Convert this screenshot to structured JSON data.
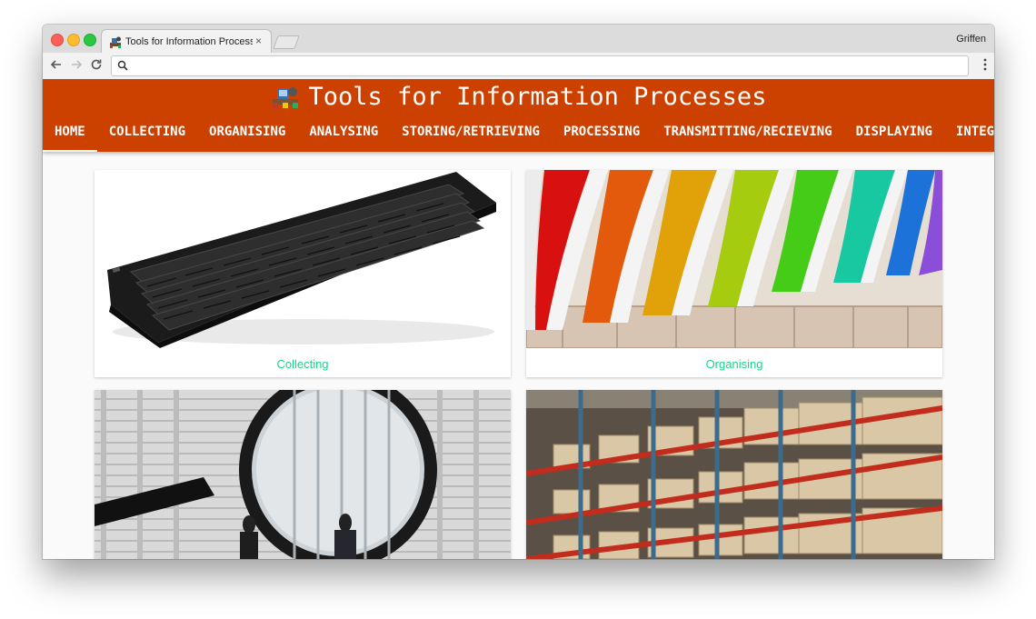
{
  "browser": {
    "tab_title": "Tools for Information Processes",
    "tab_close": "×",
    "profile_name": "Griffen",
    "address_value": "",
    "icons": {
      "back": "back-arrow-icon",
      "forward": "forward-arrow-icon",
      "reload": "reload-icon",
      "search": "search-icon",
      "menu": "kebab-menu-icon"
    }
  },
  "site": {
    "title": "Tools for Information Processes",
    "logo": "tools-logo-icon",
    "colors": {
      "header": "#cc4000",
      "accent": "#1bd38a",
      "text": "#ffffff"
    },
    "nav": [
      {
        "label": "HOME",
        "active": true
      },
      {
        "label": "COLLECTING",
        "active": false
      },
      {
        "label": "ORGANISING",
        "active": false
      },
      {
        "label": "ANALYSING",
        "active": false
      },
      {
        "label": "STORING/RETRIEVING",
        "active": false
      },
      {
        "label": "PROCESSING",
        "active": false
      },
      {
        "label": "TRANSMITTING/RECIEVING",
        "active": false
      },
      {
        "label": "DISPLAYING",
        "active": false
      },
      {
        "label": "INTEGRATION",
        "active": false
      }
    ]
  },
  "cards": [
    {
      "label": "Collecting",
      "image": "keyboard-image"
    },
    {
      "label": "Organising",
      "image": "coloured-folders-image"
    },
    {
      "label": "",
      "image": "magnifying-glass-image"
    },
    {
      "label": "",
      "image": "warehouse-shelves-image"
    }
  ]
}
